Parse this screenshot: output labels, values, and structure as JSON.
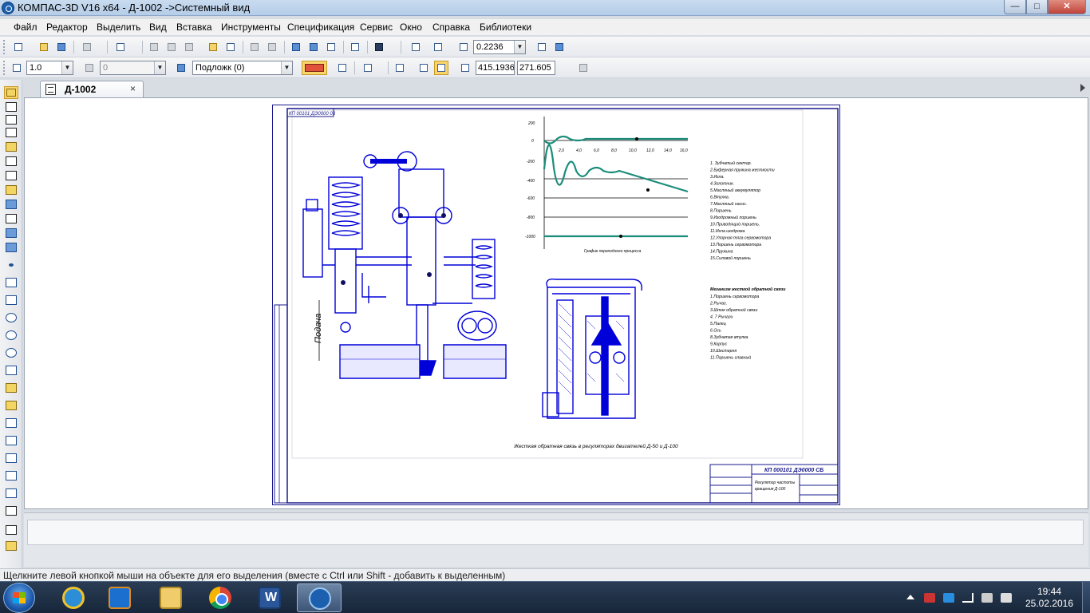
{
  "window": {
    "title": "КОМПАС-3D V16  x64 - Д-1002 ->Системный вид",
    "buttons": {
      "minimize": "—",
      "maximize": "□",
      "close": "✕"
    }
  },
  "menu": [
    "Файл",
    "Редактор",
    "Выделить",
    "Вид",
    "Вставка",
    "Инструменты",
    "Спецификация",
    "Сервис",
    "Окно",
    "Справка",
    "Библиотеки"
  ],
  "toolbar1": {
    "zoom_value": "0.2236"
  },
  "toolbar2": {
    "line_width": "1.0",
    "layer_number": "0",
    "style": "Подложк (0)",
    "coord_x": "415.1936",
    "coord_y": "271.605"
  },
  "document_tab": {
    "label": "Д-1002",
    "close": "×"
  },
  "drawing": {
    "stamp_code": "КП 000101 ДЭ0000 СБ",
    "corner_label": "КП 00101 ДЭ0000 03",
    "caption": "Жесткая обратная связь в регуляторах двигателей Д-50 и Д-100",
    "vertical_label": "Подача",
    "title_block_line1": "Регулятор частоты",
    "title_block_line2": "вращения Д-100",
    "graph_ylabels": [
      "200",
      "0",
      "-200",
      "-400",
      "-600",
      "-800",
      "-1000"
    ],
    "graph_xlabels": [
      "2,0",
      "4,0",
      "6,0",
      "8,0",
      "10,0",
      "12,0",
      "14,0",
      "16,0"
    ],
    "graph_caption": "График переходного процесса",
    "legend_a": [
      "1. Зубчатый сектор.",
      "2.Буферная пружина жесткости",
      "3.Игла.",
      "4.Золотник.",
      "5.Масляный аккумулятор",
      "6.Втулка.",
      "7.Масляный насос.",
      "8.Поршень",
      "9.Изодромный поршень",
      "10.Приводящий поршень.",
      "11.Игла изодрома",
      "12.Упорная тяга сервомотора",
      "13.Поршень сервомотора",
      "14.Пружина",
      "15.Силовой поршень"
    ],
    "legend_b_title": "Механизм жесткой обратной связи",
    "legend_b": [
      "1.Поршень сервомотора",
      "2.Рычаг.",
      "3.Шток обратной связи",
      "4. 7 Рычаги",
      "5.Палец",
      "6.Ось",
      "8.Зубчатая втулка",
      "9.Корпус",
      "10.Шестерня",
      "11.Поршень главный"
    ]
  },
  "status": {
    "message": "Щелкните левой кнопкой мыши на объекте для его выделения (вместе с Ctrl или Shift - добавить к выделенным)"
  },
  "taskbar": {
    "apps": [
      "ie-icon",
      "media-icon",
      "explorer-icon",
      "chrome-icon",
      "word-icon",
      "kompas-icon"
    ],
    "time": "19:44",
    "date": "25.02.2016"
  }
}
